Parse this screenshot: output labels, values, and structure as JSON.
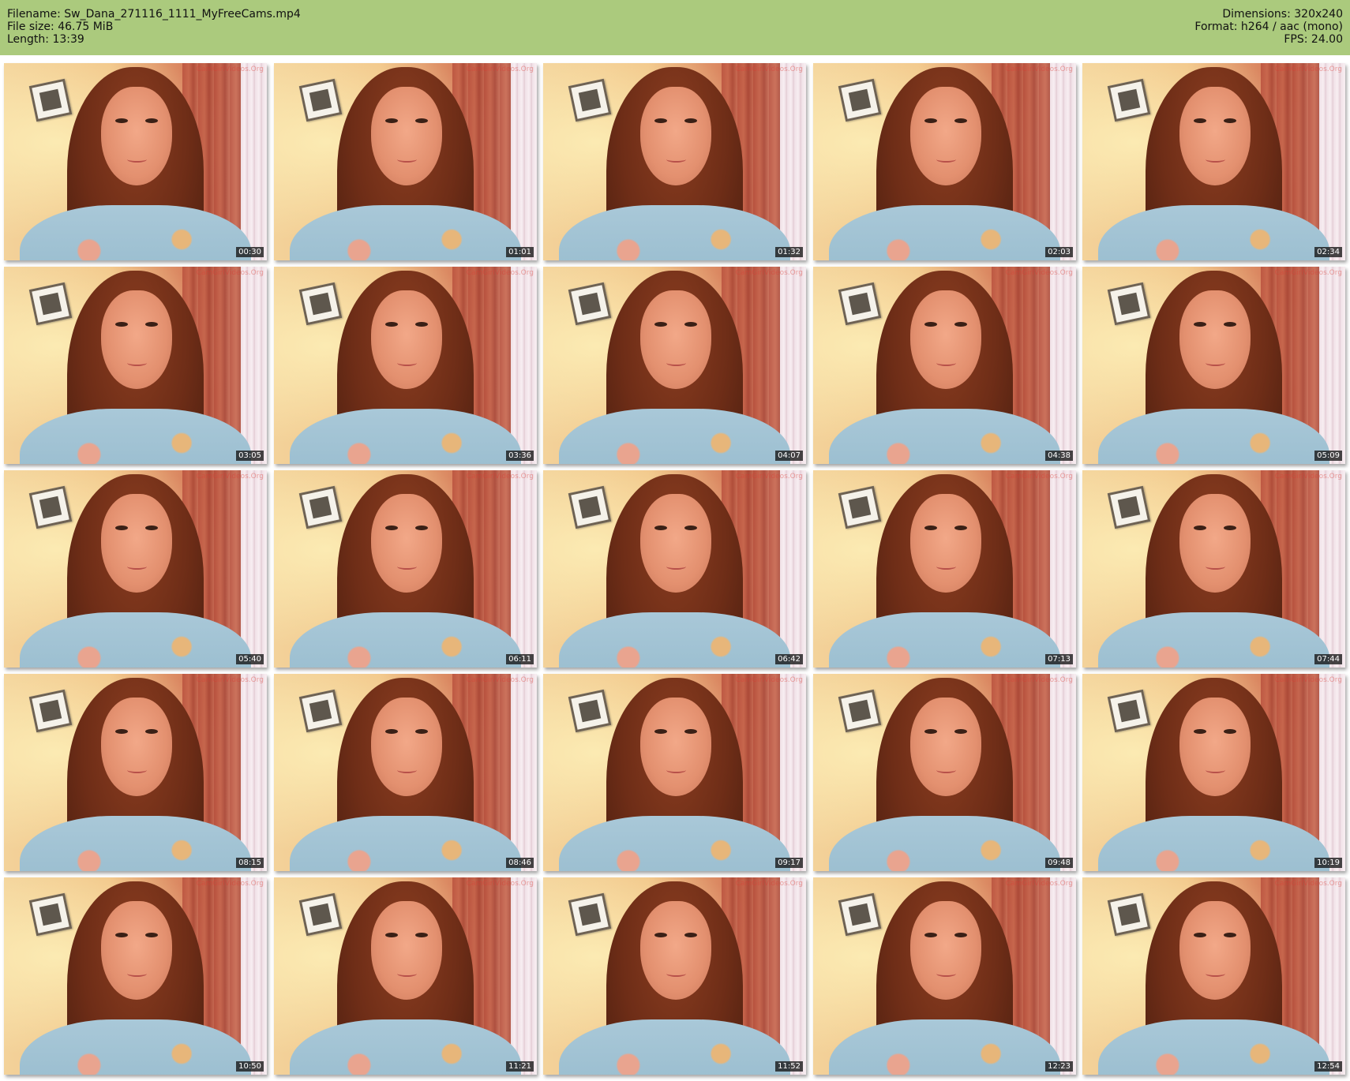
{
  "header": {
    "filename_line": "Filename: Sw_Dana_271116_1111_MyFreeCams.mp4",
    "filesize_line": "File size: 46.75 MiB",
    "length_line": "Length: 13:39",
    "dimensions_line": "Dimensions: 320x240",
    "format_line": "Format: h264 / aac (mono)",
    "fps_line": "FPS: 24.00",
    "background_color": "#abca7d"
  },
  "watermark_text": "CamGirlVideos.Org",
  "thumbnails": [
    {
      "timestamp": "00:30"
    },
    {
      "timestamp": "01:01"
    },
    {
      "timestamp": "01:32"
    },
    {
      "timestamp": "02:03"
    },
    {
      "timestamp": "02:34"
    },
    {
      "timestamp": "03:05"
    },
    {
      "timestamp": "03:36"
    },
    {
      "timestamp": "04:07"
    },
    {
      "timestamp": "04:38"
    },
    {
      "timestamp": "05:09"
    },
    {
      "timestamp": "05:40"
    },
    {
      "timestamp": "06:11"
    },
    {
      "timestamp": "06:42"
    },
    {
      "timestamp": "07:13"
    },
    {
      "timestamp": "07:44"
    },
    {
      "timestamp": "08:15"
    },
    {
      "timestamp": "08:46"
    },
    {
      "timestamp": "09:17"
    },
    {
      "timestamp": "09:48"
    },
    {
      "timestamp": "10:19"
    },
    {
      "timestamp": "10:50"
    },
    {
      "timestamp": "11:21"
    },
    {
      "timestamp": "11:52"
    },
    {
      "timestamp": "12:23"
    },
    {
      "timestamp": "12:54"
    }
  ]
}
